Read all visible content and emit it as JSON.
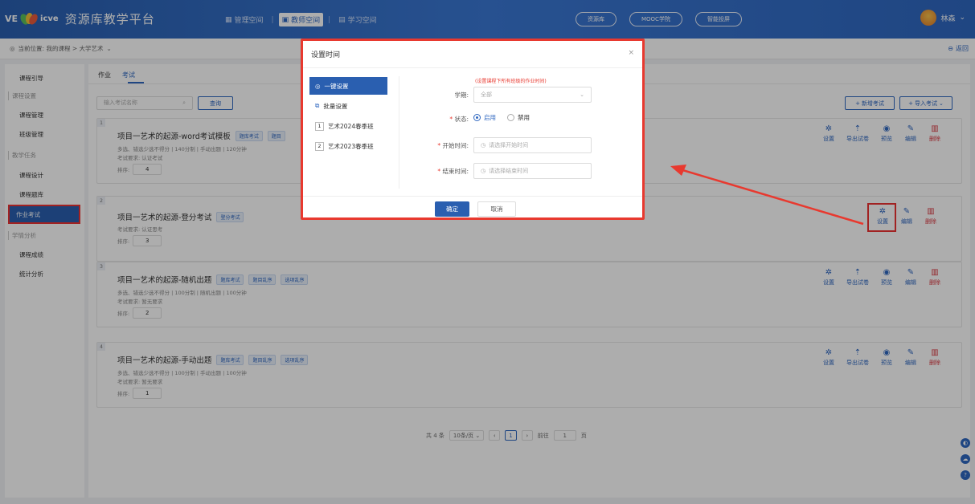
{
  "header": {
    "logo_mark": "VE",
    "logo_mark2": "icve",
    "title": "资源库教学平台",
    "nav": [
      {
        "icon": "grid-icon",
        "label": "管理空间"
      },
      {
        "icon": "teacher-icon",
        "label": "教师空间"
      },
      {
        "icon": "book-icon",
        "label": "学习空间"
      }
    ],
    "pills": [
      "资源库",
      "MOOC学院",
      "智能投屏"
    ],
    "user_name": "林森"
  },
  "breadcrumb": {
    "text": "当前位置: 我的课程 > 大学艺术",
    "back": "返回"
  },
  "sidebar": {
    "items": [
      {
        "label": "课程引导",
        "kind": "item"
      },
      {
        "label": "课程设置",
        "kind": "group"
      },
      {
        "label": "课程管理",
        "kind": "item"
      },
      {
        "label": "班级管理",
        "kind": "item"
      },
      {
        "label": "教学任务",
        "kind": "group"
      },
      {
        "label": "课程设计",
        "kind": "item"
      },
      {
        "label": "课程题库",
        "kind": "item"
      },
      {
        "label": "作业考试",
        "kind": "active"
      },
      {
        "label": "学情分析",
        "kind": "group"
      },
      {
        "label": "课程成绩",
        "kind": "item"
      },
      {
        "label": "统计分析",
        "kind": "item"
      }
    ]
  },
  "main": {
    "tabs": [
      "作业",
      "考试"
    ],
    "search_placeholder": "输入考试名称",
    "query_label": "查询",
    "add_label": "新增考试",
    "import_label": "导入考试",
    "cards": [
      {
        "num": "1",
        "title": "项目一艺术的起源-word考试模板",
        "tags": [
          "题库考试",
          "题目"
        ],
        "meta1": "多选、错选少选不得分 | 140分制 | 手动出题 | 120分钟",
        "meta2": "考试要求: 认证考试",
        "sort_label": "排序:",
        "sort": "4",
        "actions": [
          "设置",
          "导出试卷",
          "预览",
          "编辑",
          "删除"
        ]
      },
      {
        "num": "2",
        "title": "项目一艺术的起源-登分考试",
        "tags": [
          "登分考试"
        ],
        "meta1": "",
        "meta2": "考试要求: 认证思考",
        "sort_label": "排序:",
        "sort": "3",
        "actions": [
          "设置",
          "编辑",
          "删除"
        ]
      },
      {
        "num": "3",
        "title": "项目一艺术的起源-随机出题",
        "tags": [
          "题库考试",
          "题目乱序",
          "选项乱序"
        ],
        "meta1": "多选、错选少选不得分 | 100分制 | 随机出题 | 100分钟",
        "meta2": "考试要求: 暂无要求",
        "sort_label": "排序:",
        "sort": "2",
        "actions": [
          "设置",
          "导出试卷",
          "预览",
          "编辑",
          "删除"
        ]
      },
      {
        "num": "4",
        "title": "项目一艺术的起源-手动出题",
        "tags": [
          "题库考试",
          "题目乱序",
          "选项乱序"
        ],
        "meta1": "多选、错选少选不得分 | 100分制 | 手动出题 | 100分钟",
        "meta2": "考试要求: 暂无要求",
        "sort_label": "排序:",
        "sort": "1",
        "actions": [
          "设置",
          "导出试卷",
          "预览",
          "编辑",
          "删除"
        ]
      }
    ],
    "pager": {
      "total": "共 4 条",
      "page_size": "10条/页",
      "current": "1",
      "goto_label": "前往",
      "goto_value": "1",
      "page_unit": "页"
    }
  },
  "modal": {
    "title": "设置时间",
    "close": "×",
    "side": [
      {
        "icon": "target-icon",
        "label": "一键设置"
      },
      {
        "icon": "batch-icon",
        "label": "批量设置"
      },
      {
        "num": "1",
        "label": "艺术2024春季班"
      },
      {
        "num": "2",
        "label": "艺术2023春季班"
      }
    ],
    "hint": "(设置课程下所有班级的作业时间)",
    "term_label": "学期:",
    "term_value": "全部",
    "status_label": "状态:",
    "status_options": [
      "启用",
      "禁用"
    ],
    "status_selected": "启用",
    "start_label": "开始时间:",
    "start_placeholder": "请选择开始时间",
    "end_label": "结束时间:",
    "end_placeholder": "请选择结束时间",
    "ok": "确定",
    "cancel": "取消"
  },
  "colors": {
    "brand": "#2f67c0",
    "danger": "#d9363e",
    "highlight": "#e8392f"
  }
}
